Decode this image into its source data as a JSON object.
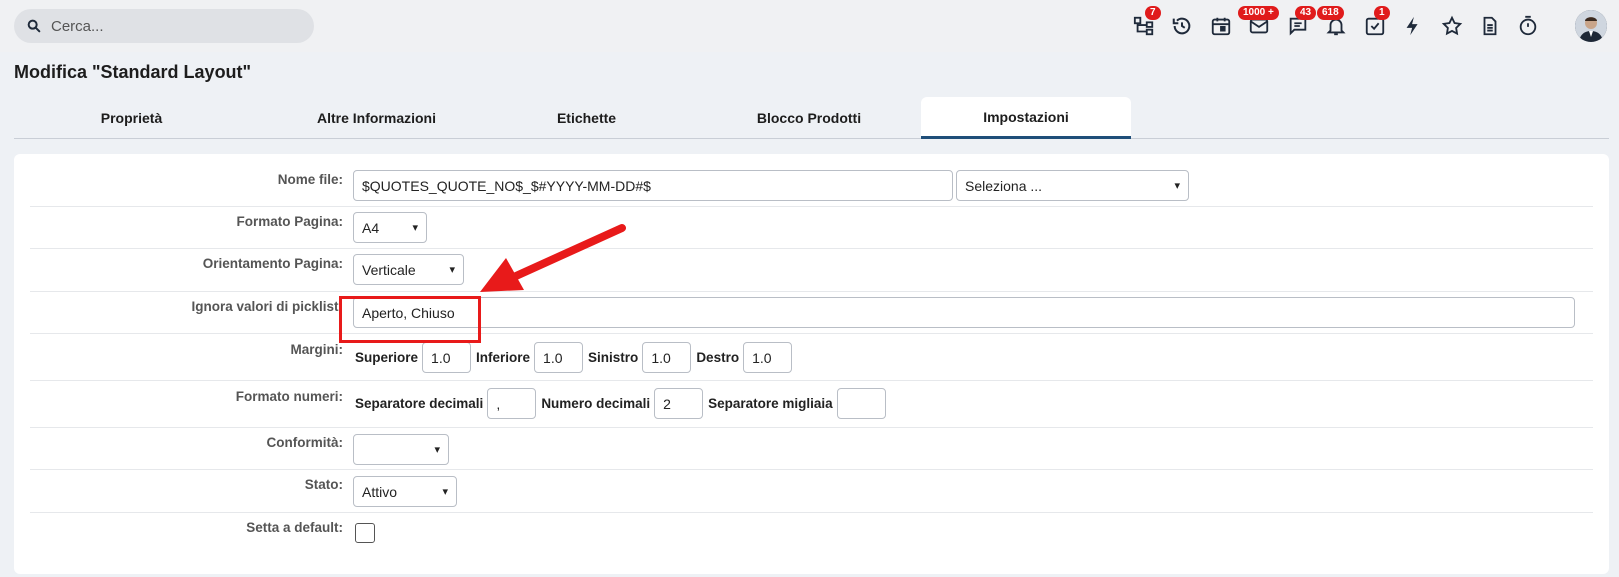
{
  "search": {
    "placeholder": "Cerca..."
  },
  "topbar": {
    "badges": {
      "tree": "7",
      "mail": "1000 +",
      "chat": "43",
      "bell": "618",
      "tasks": "1"
    }
  },
  "page": {
    "title": "Modifica \"Standard Layout\""
  },
  "tabs": [
    {
      "label": "Proprietà"
    },
    {
      "label": "Altre Informazioni"
    },
    {
      "label": "Etichette"
    },
    {
      "label": "Blocco Prodotti"
    },
    {
      "label": "Impostazioni"
    }
  ],
  "form": {
    "filename": {
      "label": "Nome file:",
      "value": "$QUOTES_QUOTE_NO$_$#YYYY-MM-DD#$",
      "select": "Seleziona ..."
    },
    "page_format": {
      "label": "Formato Pagina:",
      "value": "A4"
    },
    "orientation": {
      "label": "Orientamento Pagina:",
      "value": "Verticale"
    },
    "ignore_picklist": {
      "label": "Ignora valori di picklist:",
      "value": "Aperto, Chiuso"
    },
    "margins": {
      "label": "Margini:",
      "top_label": "Superiore",
      "top": "1.0",
      "bottom_label": "Inferiore",
      "bottom": "1.0",
      "left_label": "Sinistro",
      "left": "1.0",
      "right_label": "Destro",
      "right": "1.0"
    },
    "number_format": {
      "label": "Formato numeri:",
      "decimal_sep_label": "Separatore decimali",
      "decimal_sep": ",",
      "decimals_label": "Numero decimali",
      "decimals": "2",
      "thousands_sep_label": "Separatore migliaia",
      "thousands_sep": ""
    },
    "compliance": {
      "label": "Conformità:",
      "value": ""
    },
    "status": {
      "label": "Stato:",
      "value": "Attivo"
    },
    "default": {
      "label": "Setta a default:"
    }
  },
  "colors": {
    "accent": "#1f4e79",
    "badge": "#e01b1b",
    "highlight": "#e81a1a"
  }
}
